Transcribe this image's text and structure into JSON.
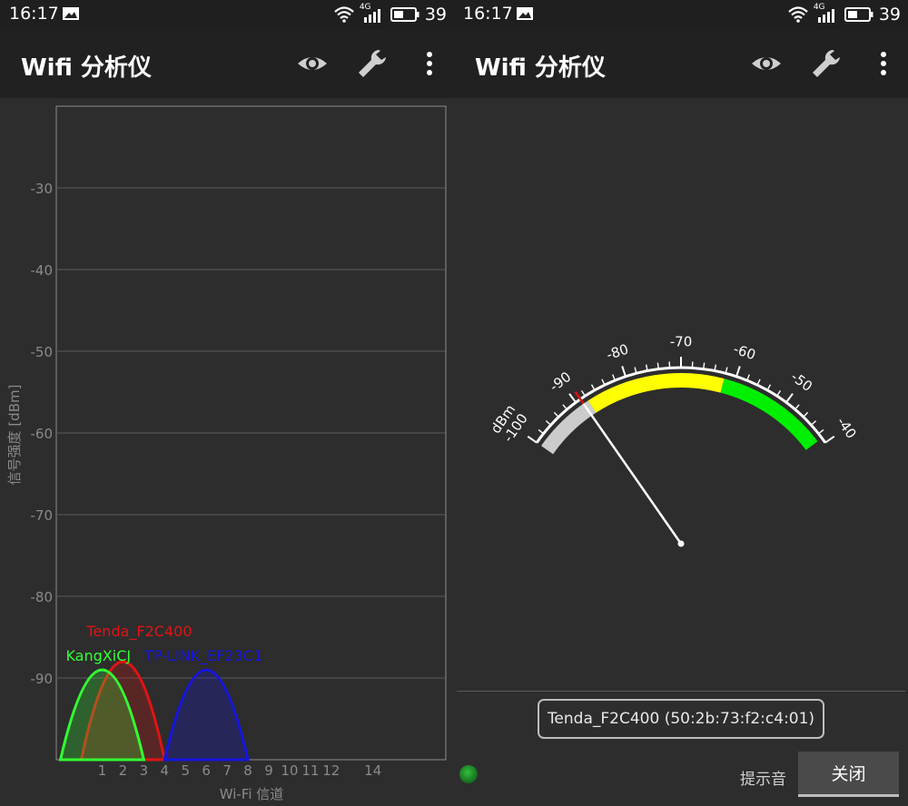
{
  "status_bar": {
    "time": "16:17",
    "network": "4G",
    "battery": "39"
  },
  "app": {
    "title": "Wifi 分析仪"
  },
  "chart_data": {
    "type": "area",
    "ylabel": "信号强度 [dBm]",
    "xlabel": "Wi-Fi 信道",
    "y_ticks": [
      "-30",
      "-40",
      "-50",
      "-60",
      "-70",
      "-80",
      "-90"
    ],
    "ylim": [
      -100,
      -20
    ],
    "x_ticks": [
      "1",
      "2",
      "3",
      "4",
      "5",
      "6",
      "7",
      "8",
      "9",
      "10",
      "11",
      "12",
      "14"
    ],
    "xlim": [
      -1.2,
      17.5
    ],
    "grid": true,
    "series": [
      {
        "name": "Tenda_F2C400",
        "channel": 2,
        "level": -88,
        "color": "#e01414"
      },
      {
        "name": "KangXiCJ",
        "channel": 1,
        "level": -89,
        "color": "#33ff33"
      },
      {
        "name": "TP-LINK_EF23C1",
        "channel": 6,
        "level": -89,
        "color": "#1515e0"
      }
    ]
  },
  "meter": {
    "unit": "dBm",
    "min": -100,
    "max": -40,
    "labels": [
      "-100",
      "-90",
      "-80",
      "-70",
      "-60",
      "-50",
      "-40"
    ],
    "zones": [
      {
        "from": -100,
        "to": -88,
        "color": "#cccccc"
      },
      {
        "from": -88,
        "to": -62,
        "color": "#ffff00"
      },
      {
        "from": -62,
        "to": -41,
        "color": "#00ee00"
      }
    ],
    "value": -89
  },
  "selected_network": "Tenda_F2C400 (50:2b:73:f2:c4:01)",
  "controls": {
    "sound_label": "提示音",
    "close_label": "关闭"
  }
}
